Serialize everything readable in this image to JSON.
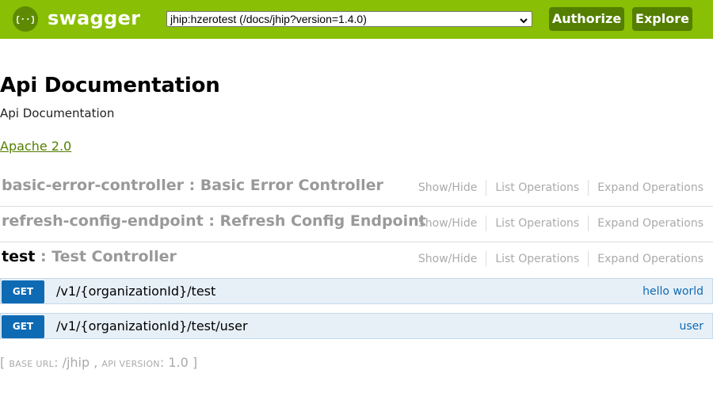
{
  "header": {
    "brand": "swagger",
    "spec_select_value": "jhip:hzerotest (/docs/jhip?version=1.4.0)",
    "authorize_label": "Authorize",
    "explore_label": "Explore",
    "brand_color": "#89bf04",
    "button_color": "#547f00"
  },
  "info": {
    "title": "Api Documentation",
    "description": "Api Documentation",
    "license": "Apache 2.0"
  },
  "resources": [
    {
      "name": "basic-error-controller",
      "separator": " : ",
      "description": "Basic Error Controller",
      "show_hide": "Show/Hide",
      "list_operations": "List Operations",
      "expand_operations": "Expand Operations"
    },
    {
      "name": "refresh-config-endpoint",
      "separator": " : ",
      "description": "Refresh Config Endpoint",
      "show_hide": "Show/Hide",
      "list_operations": "List Operations",
      "expand_operations": "Expand Operations"
    },
    {
      "name": "test",
      "separator": " : ",
      "description": "Test Controller",
      "show_hide": "Show/Hide",
      "list_operations": "List Operations",
      "expand_operations": "Expand Operations"
    }
  ],
  "operations": [
    {
      "method": "GET",
      "path": "/v1/{organizationId}/test",
      "summary": "hello world"
    },
    {
      "method": "GET",
      "path": "/v1/{organizationId}/test/user",
      "summary": "user"
    }
  ],
  "footer": {
    "open_bracket": "[",
    "base_url_label": "BASE URL",
    "base_url_value": "/jhip",
    "api_version_label": "API VERSION",
    "api_version_value": "1.0",
    "close_bracket": "]"
  },
  "colors": {
    "get_method": "#0f6ab4",
    "operation_bg": "#e7f0f7",
    "link": "#547f00"
  }
}
